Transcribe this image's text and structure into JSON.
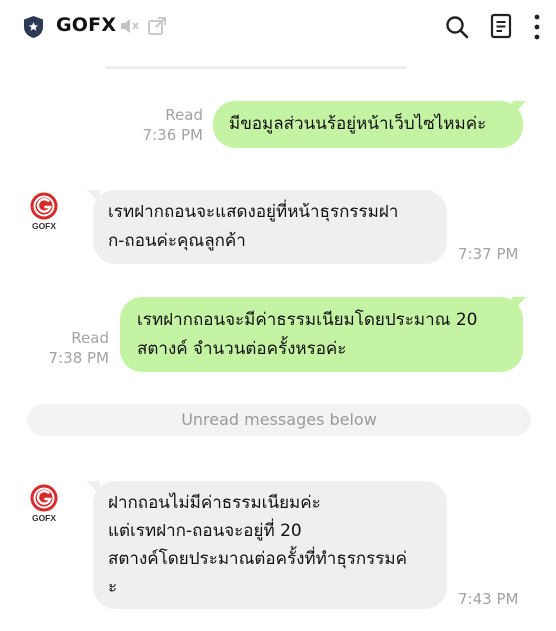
{
  "header": {
    "title": "GOFX",
    "icons": [
      "shield-star-icon",
      "speaker-muted-icon",
      "popout-icon",
      "search-icon",
      "notes-icon",
      "more-vertical-icon"
    ]
  },
  "avatar_label": "GOFX",
  "colors": {
    "outgoing_bubble": "#c4f3a4",
    "incoming_bubble": "#efefef",
    "brand_red": "#d62a2a",
    "meta_text": "#a3a3a3"
  },
  "messages": [
    {
      "direction": "out",
      "status": "Read",
      "time": "7:36 PM",
      "lines": [
        "มีขอมูลส่วนนร้อยู่หน้าเว็บไซไหมค่ะ"
      ]
    },
    {
      "direction": "in",
      "time": "7:37 PM",
      "lines": [
        "เรทฝากถอนจะแสดงอยู่ที่หน้าธุรกรรมฝา",
        "ก-ถอนค่ะคุณลูกค้า"
      ]
    },
    {
      "direction": "out",
      "status": "Read",
      "time": "7:38 PM",
      "lines": [
        "เรทฝากถอนจะมีค่าธรรมเนียมโดยประมาณ 20",
        "สตางค์ จำนวนต่อครั้งหรอค่ะ"
      ]
    },
    {
      "direction": "in",
      "time": "7:43 PM",
      "lines": [
        "ฝากถอนไม่มีค่าธรรมเนียมค่ะ",
        "แต่เรทฝาก-ถอนจะอยู่ที่ 20",
        "สตางค์โดยประมาณต่อครั้งที่ทำธุรกรรมค่",
        "ะ"
      ]
    }
  ],
  "unread_banner": "Unread messages below"
}
